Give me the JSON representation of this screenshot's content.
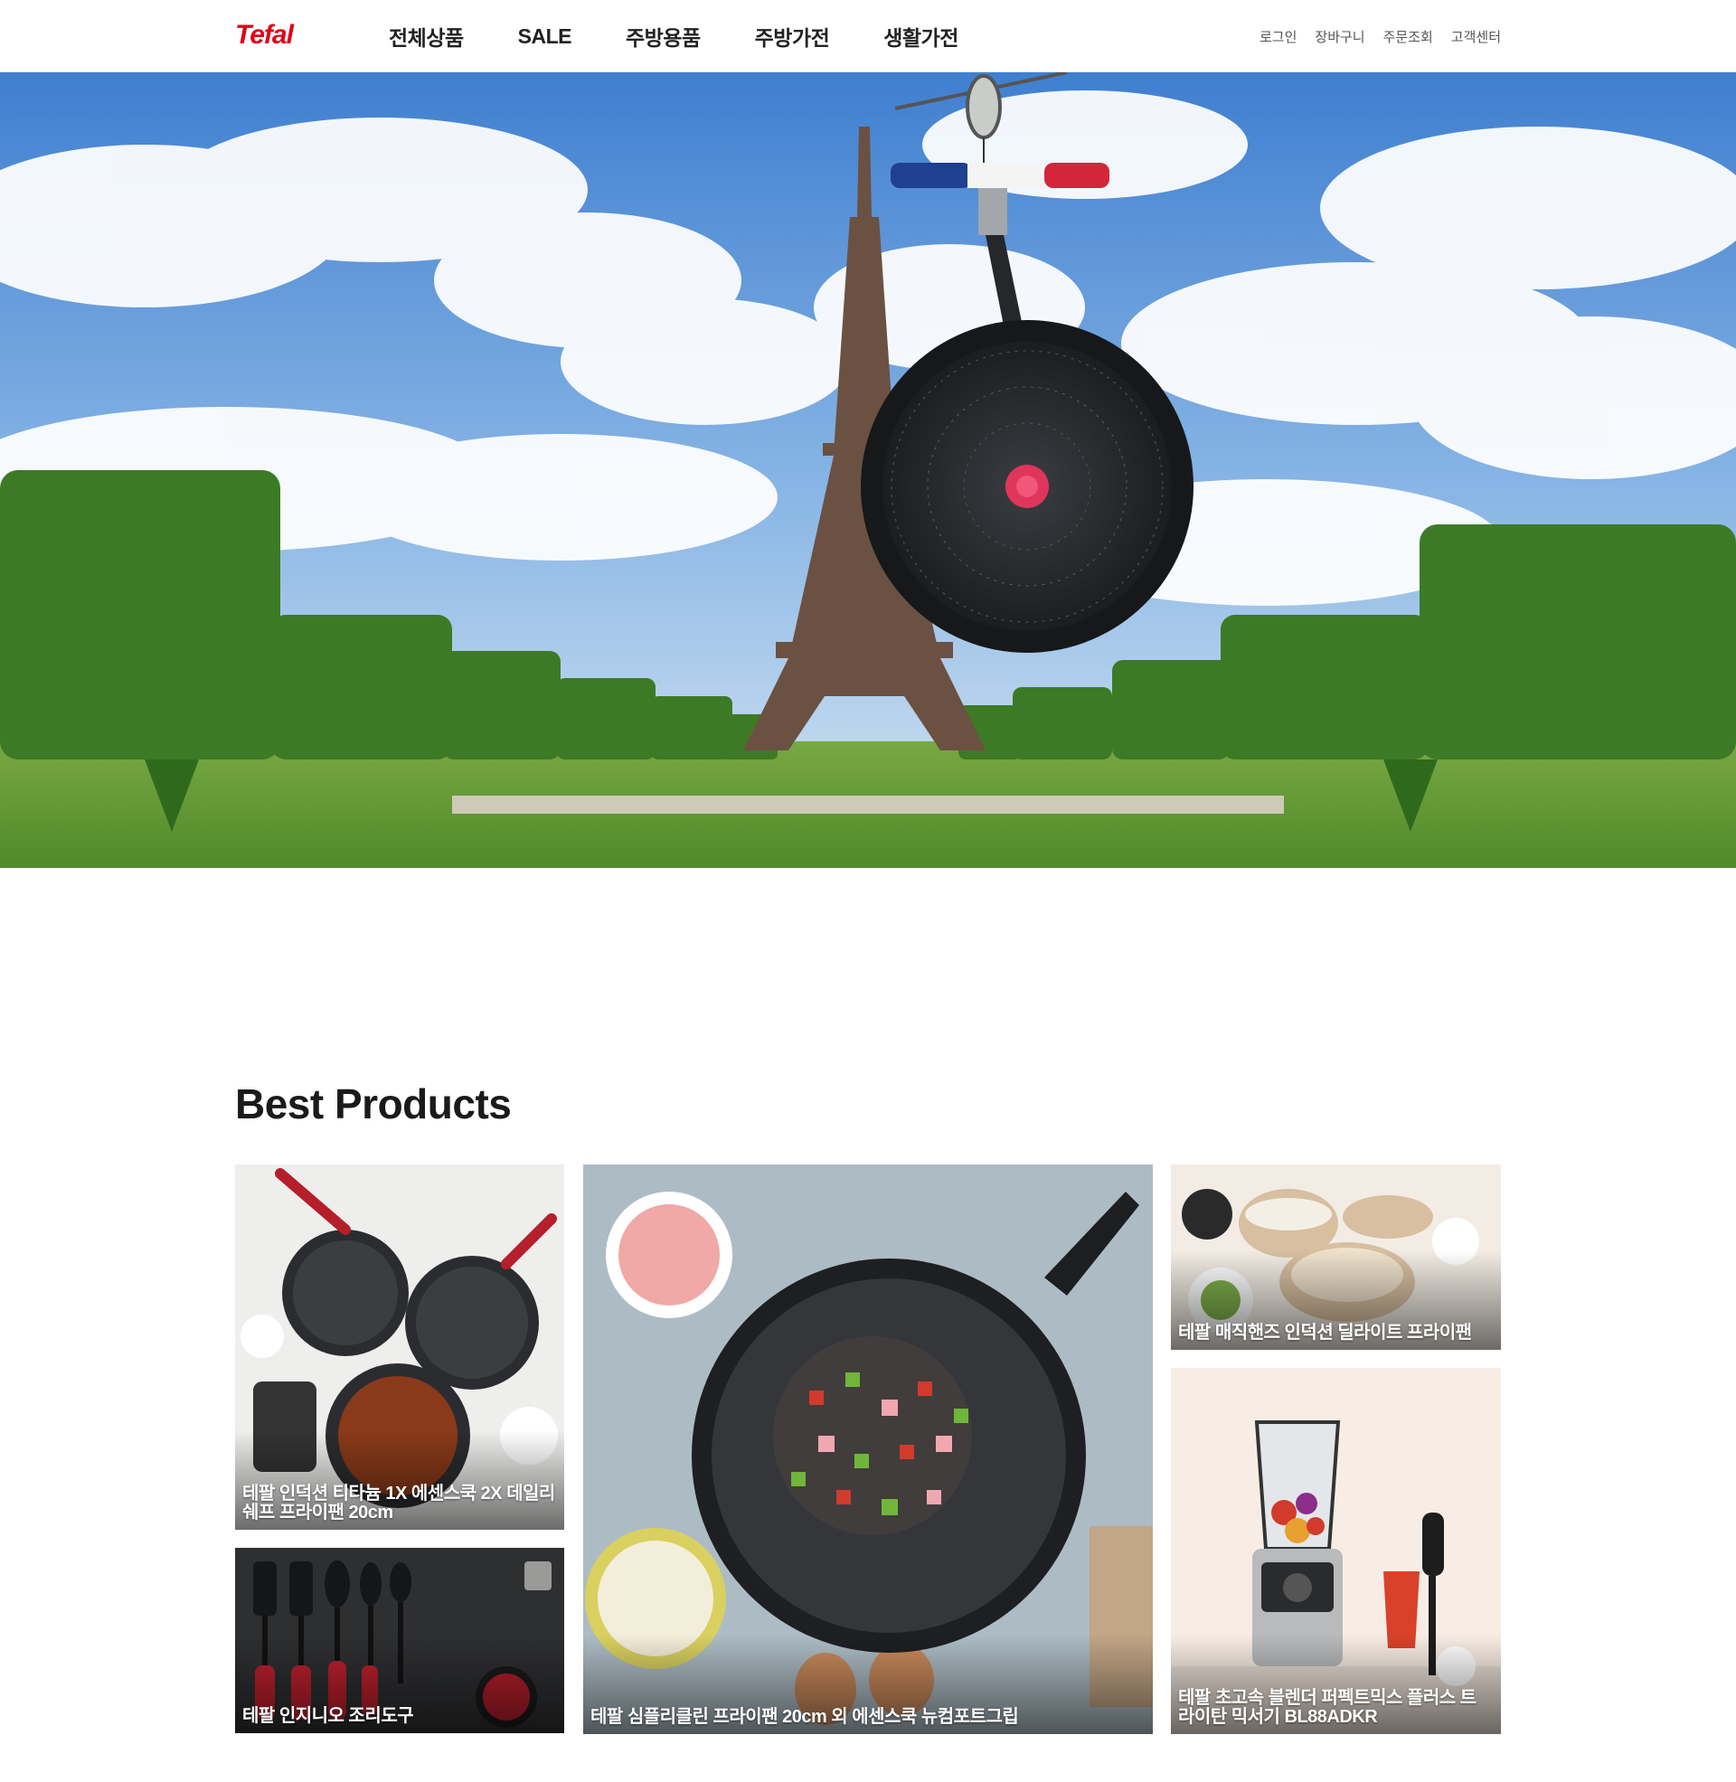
{
  "header": {
    "logo": "Tefal",
    "nav": [
      "전체상품",
      "SALE",
      "주방용품",
      "주방가전",
      "생활가전"
    ],
    "util": [
      "로그인",
      "장바구니",
      "주문조회",
      "고객센터"
    ]
  },
  "hero": {
    "slide_count": 5,
    "active_slide": 1
  },
  "best": {
    "title": "Best Products",
    "products": [
      {
        "name": "테팔 인덕션 티타늄 1X 에센스쿡 2X 데일리쉐프 프라이팬 20cm"
      },
      {
        "name": "테팔 인지니오 조리도구"
      },
      {
        "name": "테팔 심플리클린 프라이팬 20cm 외 에센스쿡 뉴컴포트그립"
      },
      {
        "name": "테팔 매직핸즈 인덕션 딜라이트 프라이팬"
      },
      {
        "name": "테팔 초고속 블렌더 퍼펙트믹스 플러스 트라이탄 믹서기 BL88ADKR"
      }
    ]
  },
  "colors": {
    "brand": "#e2001a",
    "text": "#1a1a1a"
  }
}
